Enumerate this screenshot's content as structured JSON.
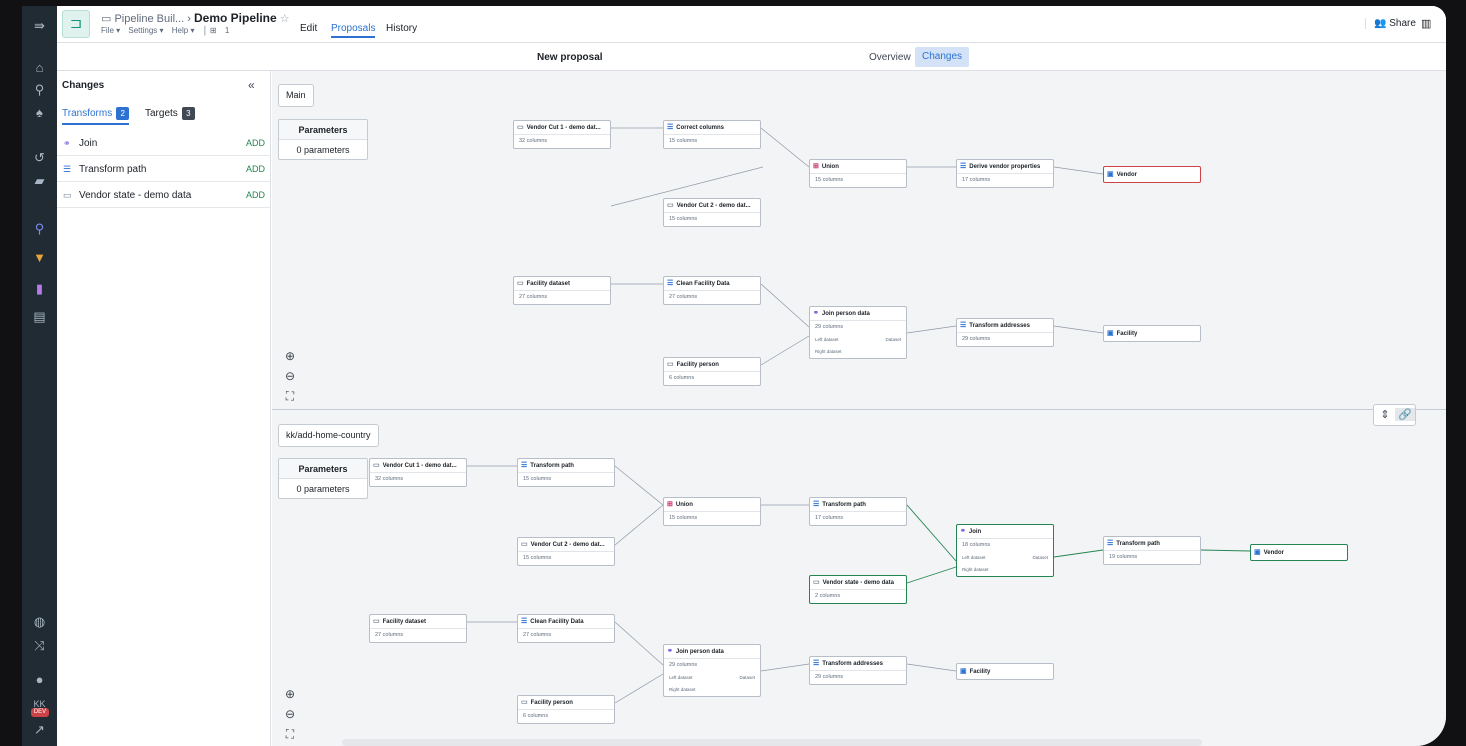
{
  "app": {
    "breadcrumb_parent": "Pipeline Buil...",
    "pipeline_name": "Demo Pipeline",
    "menus": [
      "File ▾",
      "Settings ▾",
      "Help ▾"
    ],
    "branch_count": "1",
    "tabs": {
      "edit": "Edit",
      "proposals": "Proposals",
      "history": "History"
    },
    "share": "Share",
    "user_initials": "KK",
    "env_badge": "DEV"
  },
  "subheader": {
    "title": "New proposal",
    "overview": "Overview",
    "changes": "Changes"
  },
  "panel": {
    "title": "Changes",
    "tabs": {
      "transforms": "Transforms",
      "transforms_count": "2",
      "targets": "Targets",
      "targets_count": "3"
    },
    "items": [
      {
        "name": "Join",
        "icon": "join-icon",
        "status": "ADD"
      },
      {
        "name": "Transform path",
        "icon": "transform-icon",
        "status": "ADD"
      },
      {
        "name": "Vendor state - demo data",
        "icon": "dataset-icon",
        "status": "ADD"
      }
    ]
  },
  "main": {
    "branch": "Main",
    "parameters_title": "Parameters",
    "parameters_value": "0 parameters",
    "nodes": {
      "vc1": {
        "title": "Vendor Cut 1 - demo dat...",
        "cols": "32 columns"
      },
      "cc": {
        "title": "Correct columns",
        "cols": "15 columns"
      },
      "vc2": {
        "title": "Vendor Cut 2 - demo dat...",
        "cols": "15 columns"
      },
      "un": {
        "title": "Union",
        "cols": "15 columns"
      },
      "dvp": {
        "title": "Derive vendor properties",
        "cols": "17 columns"
      },
      "ven": {
        "title": "Vendor"
      },
      "fd": {
        "title": "Facility dataset",
        "cols": "27 columns"
      },
      "cfd": {
        "title": "Clean Facility Data",
        "cols": "27 columns"
      },
      "jpd": {
        "title": "Join person data",
        "cols": "29 columns",
        "left": "Left dataset",
        "right": "Right dataset",
        "out": "Dataset"
      },
      "ta": {
        "title": "Transform addresses",
        "cols": "29 columns"
      },
      "fac": {
        "title": "Facility"
      },
      "fp": {
        "title": "Facility person",
        "cols": "6 columns"
      }
    }
  },
  "branch": {
    "name": "kk/add-home-country",
    "parameters_title": "Parameters",
    "parameters_value": "0 parameters",
    "nodes": {
      "vc1": {
        "title": "Vendor Cut 1 - demo dat...",
        "cols": "32 columns"
      },
      "tp1": {
        "title": "Transform path",
        "cols": "15 columns"
      },
      "vc2": {
        "title": "Vendor Cut 2 - demo dat...",
        "cols": "15 columns"
      },
      "un": {
        "title": "Union",
        "cols": "15 columns"
      },
      "tp2": {
        "title": "Transform path",
        "cols": "17 columns"
      },
      "jn": {
        "title": "Join",
        "cols": "18 columns",
        "left": "Left dataset",
        "right": "Right dataset",
        "out": "Dataset"
      },
      "vs": {
        "title": "Vendor state - demo data",
        "cols": "2 columns"
      },
      "tp3": {
        "title": "Transform path",
        "cols": "19 columns"
      },
      "ven": {
        "title": "Vendor"
      },
      "fd": {
        "title": "Facility dataset",
        "cols": "27 columns"
      },
      "cfd": {
        "title": "Clean Facility Data",
        "cols": "27 columns"
      },
      "jpd": {
        "title": "Join person data",
        "cols": "29 columns",
        "left": "Left dataset",
        "right": "Right dataset",
        "out": "Dataset"
      },
      "ta": {
        "title": "Transform addresses",
        "cols": "29 columns"
      },
      "fac": {
        "title": "Facility"
      },
      "fp": {
        "title": "Facility person",
        "cols": "6 columns"
      }
    }
  },
  "colors": {
    "accent": "#2d72d2",
    "added": "#238551",
    "removed": "#cd4246"
  }
}
